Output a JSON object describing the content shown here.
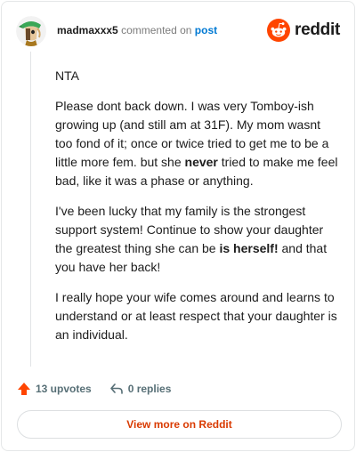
{
  "header": {
    "username": "madmaxxx5",
    "action_text": "commented on",
    "post_link": "post",
    "logo_text": "reddit"
  },
  "comment": {
    "p1": "NTA",
    "p2_a": "Please dont back down. I was very Tomboy-ish growing up (and still am at 31F). My mom wasnt too fond of it; once or twice tried to get me to be a little more fem. but she ",
    "p2_b": "never",
    "p2_c": " tried to make me feel bad, like it was a phase or anything.",
    "p3_a": "I've been lucky that my family is the strongest support system! Continue to show your daughter the greatest thing she can be ",
    "p3_b": "is herself!",
    "p3_c": " and that you have her back!",
    "p4": "I really hope your wife comes around and learns to understand or at least respect that your daughter is an individual."
  },
  "footer": {
    "upvotes": "13 upvotes",
    "replies": "0 replies",
    "view_more": "View more on Reddit"
  },
  "colors": {
    "accent": "#ff4500",
    "link": "#0079d3",
    "button_text": "#d93a00"
  },
  "icons": [
    "avatar",
    "reddit-logo-icon",
    "upvote-arrow-icon",
    "reply-icon"
  ]
}
